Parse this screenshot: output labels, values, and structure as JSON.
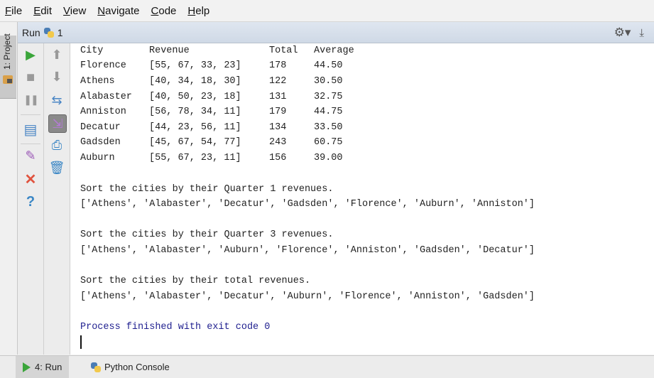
{
  "menubar": {
    "items": [
      {
        "mnemonic": "F",
        "rest": "ile"
      },
      {
        "mnemonic": "E",
        "rest": "dit"
      },
      {
        "mnemonic": "V",
        "rest": "iew"
      },
      {
        "mnemonic": "N",
        "rest": "avigate"
      },
      {
        "mnemonic": "C",
        "rest": "ode"
      },
      {
        "mnemonic": "H",
        "rest": "elp"
      }
    ]
  },
  "left_strip": {
    "project_tab": "1: Project"
  },
  "run_panel": {
    "title": "Run",
    "config_number": "1",
    "icons": {
      "settings": "gear-icon",
      "hide": "pin-down-icon"
    }
  },
  "toolbar_left": [
    {
      "name": "rerun",
      "icon": "play-icon",
      "glyph": "▶",
      "color": "#3aa53a"
    },
    {
      "name": "stop",
      "icon": "stop-icon",
      "glyph": "■",
      "color": "#9a9a9a"
    },
    {
      "name": "pause",
      "icon": "pause-icon",
      "glyph": "❚❚",
      "color": "#9a9a9a"
    },
    {
      "name": "restore-layout",
      "icon": "layout-icon",
      "glyph": "▤",
      "color": "#4a86c5"
    },
    {
      "name": "pin-tab",
      "icon": "pin-icon",
      "glyph": "✎",
      "color": "#9b59b6"
    },
    {
      "name": "close",
      "icon": "close-icon",
      "glyph": "✕",
      "color": "#e0533e"
    },
    {
      "name": "help",
      "icon": "help-icon",
      "glyph": "?",
      "color": "#3a86c5"
    }
  ],
  "toolbar_right": [
    {
      "name": "up-stack",
      "icon": "arrow-up-icon",
      "glyph": "🡑",
      "color": "#9a9a9a"
    },
    {
      "name": "down-stack",
      "icon": "arrow-down-icon",
      "glyph": "🡓",
      "color": "#9a9a9a"
    },
    {
      "name": "soft-wrap",
      "icon": "soft-wrap-icon",
      "glyph": "⇆",
      "color": "#4a86c5"
    },
    {
      "name": "scroll-to-end",
      "icon": "scroll-end-icon",
      "glyph": "⇲",
      "color": "#9b59b6"
    },
    {
      "name": "print",
      "icon": "print-icon",
      "glyph": "⎙",
      "color": "#3a86c5"
    },
    {
      "name": "clear-all",
      "icon": "trash-icon",
      "glyph": "🗑",
      "color": "#3a86c5"
    }
  ],
  "console": {
    "table": {
      "headers": [
        "City",
        "Revenue",
        "Total",
        "Average"
      ],
      "rows": [
        [
          "Florence",
          "[55, 67, 33, 23]",
          "178",
          "44.50"
        ],
        [
          "Athens",
          "[40, 34, 18, 30]",
          "122",
          "30.50"
        ],
        [
          "Alabaster",
          "[40, 50, 23, 18]",
          "131",
          "32.75"
        ],
        [
          "Anniston",
          "[56, 78, 34, 11]",
          "179",
          "44.75"
        ],
        [
          "Decatur",
          "[44, 23, 56, 11]",
          "134",
          "33.50"
        ],
        [
          "Gadsden",
          "[45, 67, 54, 77]",
          "243",
          "60.75"
        ],
        [
          "Auburn",
          "[55, 67, 23, 11]",
          "156",
          "39.00"
        ]
      ]
    },
    "sorts": [
      {
        "heading": "Sort the cities by their Quarter 1 revenues.",
        "result": "['Athens', 'Alabaster', 'Decatur', 'Gadsden', 'Florence', 'Auburn', 'Anniston']"
      },
      {
        "heading": "Sort the cities by their Quarter 3 revenues.",
        "result": "['Athens', 'Alabaster', 'Auburn', 'Florence', 'Anniston', 'Gadsden', 'Decatur']"
      },
      {
        "heading": "Sort the cities by their total revenues.",
        "result": "['Athens', 'Alabaster', 'Decatur', 'Auburn', 'Florence', 'Anniston', 'Gadsden']"
      }
    ],
    "exit_message": "Process finished with exit code 0"
  },
  "bottom_tabs": [
    {
      "label": "4: Run",
      "active": true
    },
    {
      "label": "Python Console",
      "active": false
    }
  ]
}
